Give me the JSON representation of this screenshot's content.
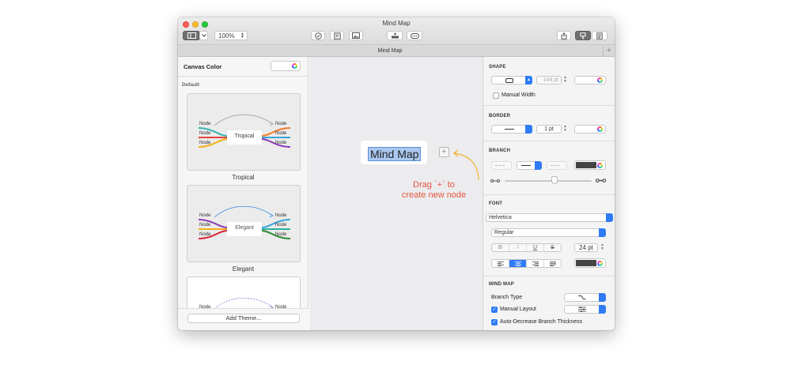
{
  "window": {
    "title": "Mind Map",
    "tab_label": "Mind Map",
    "zoom": "100%"
  },
  "left_panel": {
    "canvas_color_label": "Canvas Color",
    "section_label": "Default",
    "themes": [
      {
        "name": "Tropical",
        "center": "Tropical",
        "node_label": "Node",
        "colors": [
          "#3cb4b4",
          "#e8423c",
          "#f2b21a",
          "#f27d2a",
          "#3aa5d8",
          "#8b3fb6"
        ]
      },
      {
        "name": "Elegant",
        "center": "Elegant",
        "node_label": "Node",
        "colors": [
          "#8b3fb6",
          "#f2b21a",
          "#d8283c",
          "#3aa5d8",
          "#2fb0a0",
          "#2e8b3a"
        ]
      },
      {
        "name": "",
        "center": "",
        "node_label": "Node",
        "colors": [
          "#9b6bd0"
        ]
      }
    ],
    "add_theme_label": "Add Theme..."
  },
  "canvas": {
    "node_text": "Mind Map",
    "hint_line1": "Drag `+` to",
    "hint_line2": "create new node",
    "hint_color": "#e6553a"
  },
  "inspector": {
    "shape": {
      "header": "SHAPE",
      "width_value": "144 pt",
      "manual_width_label": "Manual Width",
      "manual_width_checked": false
    },
    "border": {
      "header": "BORDER",
      "width_value": "1 pt"
    },
    "branch": {
      "header": "BRANCH",
      "color": "#444444"
    },
    "font": {
      "header": "FONT",
      "family": "Helvetica",
      "style": "Regular",
      "size": "24 pt",
      "color": "#444444",
      "style_buttons": [
        "B",
        "I",
        "U",
        "S"
      ]
    },
    "mind_map": {
      "header": "MIND MAP",
      "branch_type_label": "Branch Type",
      "manual_layout_label": "Manual Layout",
      "manual_layout_checked": true,
      "auto_decrease_label": "Auto-Decrease Branch Thickness",
      "auto_decrease_checked": true
    }
  }
}
